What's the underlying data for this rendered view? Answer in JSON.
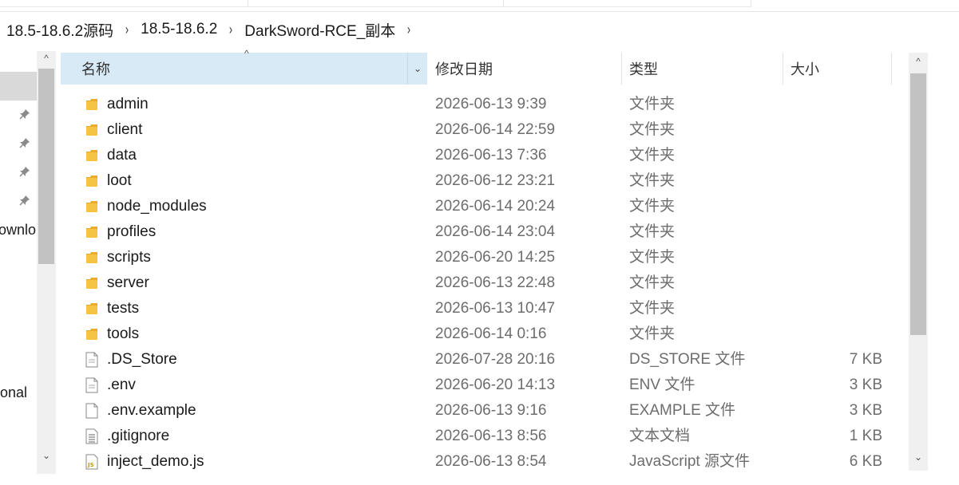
{
  "breadcrumb": {
    "items": [
      "18.5-18.6.2源码",
      "18.5-18.6.2",
      "DarkSword-RCE_副本"
    ],
    "separator": "›"
  },
  "nav": {
    "partial_labels": [
      "ownlo",
      "onal"
    ],
    "pin_icon_glyph": "📌"
  },
  "columns": {
    "name": "名称",
    "date": "修改日期",
    "type": "类型",
    "size": "大小",
    "sort_indicator": "^",
    "dropdown_glyph": "⌄"
  },
  "scrollbar": {
    "up_arrow": "^",
    "down_arrow": "⌄"
  },
  "files": [
    {
      "name": "admin",
      "date": "2026-06-13 9:39",
      "type": "文件夹",
      "size": "",
      "icon": "folder-icon"
    },
    {
      "name": "client",
      "date": "2026-06-14 22:59",
      "type": "文件夹",
      "size": "",
      "icon": "folder-icon"
    },
    {
      "name": "data",
      "date": "2026-06-13 7:36",
      "type": "文件夹",
      "size": "",
      "icon": "folder-icon"
    },
    {
      "name": "loot",
      "date": "2026-06-12 23:21",
      "type": "文件夹",
      "size": "",
      "icon": "folder-icon"
    },
    {
      "name": "node_modules",
      "date": "2026-06-14 20:24",
      "type": "文件夹",
      "size": "",
      "icon": "folder-icon"
    },
    {
      "name": "profiles",
      "date": "2026-06-14 23:04",
      "type": "文件夹",
      "size": "",
      "icon": "folder-icon"
    },
    {
      "name": "scripts",
      "date": "2026-06-20 14:25",
      "type": "文件夹",
      "size": "",
      "icon": "folder-icon"
    },
    {
      "name": "server",
      "date": "2026-06-13 22:48",
      "type": "文件夹",
      "size": "",
      "icon": "folder-icon"
    },
    {
      "name": "tests",
      "date": "2026-06-13 10:47",
      "type": "文件夹",
      "size": "",
      "icon": "folder-icon"
    },
    {
      "name": "tools",
      "date": "2026-06-14 0:16",
      "type": "文件夹",
      "size": "",
      "icon": "folder-icon"
    },
    {
      "name": ".DS_Store",
      "date": "2026-07-28 20:16",
      "type": "DS_STORE 文件",
      "size": "7 KB",
      "icon": "file-icon"
    },
    {
      "name": ".env",
      "date": "2026-06-20 14:13",
      "type": "ENV 文件",
      "size": "3 KB",
      "icon": "file-icon"
    },
    {
      "name": ".env.example",
      "date": "2026-06-13 9:16",
      "type": "EXAMPLE 文件",
      "size": "3 KB",
      "icon": "blank-file-icon"
    },
    {
      "name": ".gitignore",
      "date": "2026-06-13 8:56",
      "type": "文本文档",
      "size": "1 KB",
      "icon": "text-file-icon"
    },
    {
      "name": "inject_demo.js",
      "date": "2026-06-13 8:54",
      "type": "JavaScript 源文件",
      "size": "6 KB",
      "icon": "js-file-icon"
    }
  ],
  "colors": {
    "header_selected": "#d9eaf7",
    "folder": "#f6c445",
    "muted_text": "#6d6d6d",
    "scroll_thumb": "#c2c2c2"
  }
}
